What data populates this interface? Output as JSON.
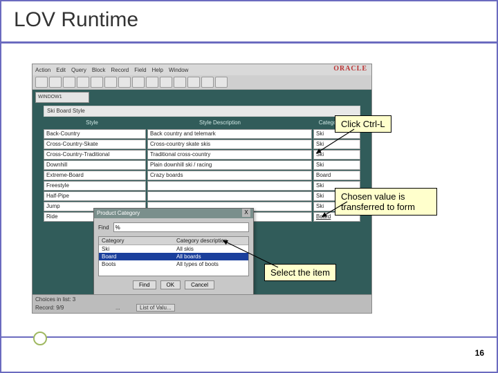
{
  "slide": {
    "title": "LOV Runtime",
    "page_number": "16"
  },
  "app": {
    "brand": "ORACLE",
    "menu": [
      "Action",
      "Edit",
      "Query",
      "Block",
      "Record",
      "Field",
      "Help",
      "Window"
    ],
    "window_label": "WINDOW1",
    "form_title": "Ski Board Style",
    "columns": [
      "Style",
      "Style Description",
      "Category"
    ],
    "rows": [
      {
        "style": "Back-Country",
        "desc": "Back country and telemark",
        "cat": "Ski"
      },
      {
        "style": "Cross-Country-Skate",
        "desc": "Cross-country skate skis",
        "cat": "Ski"
      },
      {
        "style": "Cross-Country-Traditional",
        "desc": "Traditional cross-country",
        "cat": "Ski"
      },
      {
        "style": "Downhill",
        "desc": "Plain downhill ski / racing",
        "cat": "Ski"
      },
      {
        "style": "Extreme-Board",
        "desc": "Crazy boards",
        "cat": "Board"
      },
      {
        "style": "Freestyle",
        "desc": "",
        "cat": "Ski"
      },
      {
        "style": "Half-Pipe",
        "desc": "",
        "cat": "Ski"
      },
      {
        "style": "Jump",
        "desc": "",
        "cat": "Ski"
      },
      {
        "style": "Ride",
        "desc": "",
        "cat": "Board"
      }
    ],
    "status": {
      "line1": "Choices in list: 3",
      "line2": "Record: 9/9",
      "dots": "...",
      "hint": "List of Valu..."
    }
  },
  "lov": {
    "title": "Product Category",
    "close_x": "X",
    "find_label": "Find",
    "find_value": "%",
    "headers": [
      "Category",
      "Category description"
    ],
    "rows": [
      {
        "cat": "Ski",
        "desc": "All skis",
        "selected": false
      },
      {
        "cat": "Board",
        "desc": "All boards",
        "selected": true
      },
      {
        "cat": "Boots",
        "desc": "All types of boots",
        "selected": false
      }
    ],
    "buttons": {
      "find": "Find",
      "ok": "OK",
      "cancel": "Cancel"
    }
  },
  "callouts": {
    "c1": "Click Ctrl-L",
    "c2": "Chosen value is transferred to form",
    "c3": "Select the item"
  }
}
